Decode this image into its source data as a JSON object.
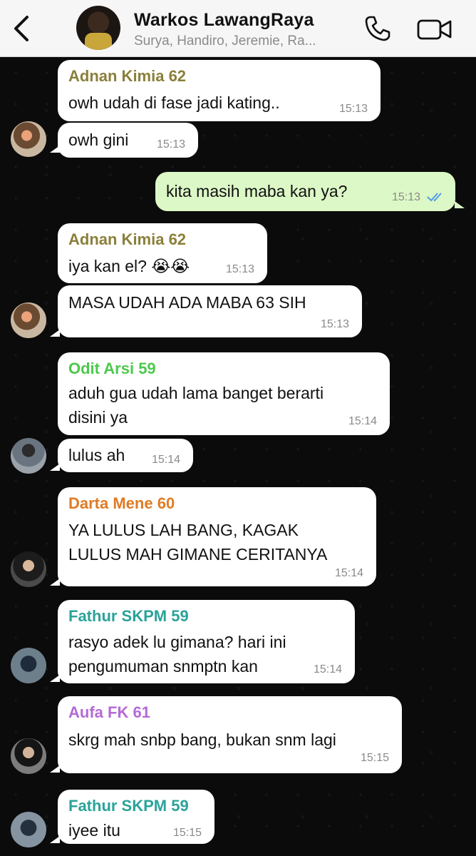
{
  "header": {
    "title": "Warkos LawangRaya",
    "subtitle": "Surya, Handiro, Jeremie, Ra..."
  },
  "icons": {
    "back": "chevron-left-icon",
    "call": "phone-icon",
    "video": "video-camera-icon",
    "read": "double-check-icon"
  },
  "colors": {
    "incoming": "#ffffff",
    "outgoing": "#dcf8c6",
    "name_adnan": "#8a7f3a",
    "name_odit": "#4cc94c",
    "name_darta": "#e07b25",
    "name_fathur": "#2aa39a",
    "name_aufa": "#b56ad6",
    "read_check": "#4f9bea"
  },
  "messages": [
    {
      "sender": "Adnan Kimia 62",
      "text": "owh udah di fase jadi kating..",
      "time": "15:13"
    },
    {
      "text": "owh gini",
      "time": "15:13"
    },
    {
      "text": "kita masih maba kan ya?",
      "time": "15:13",
      "outgoing": true
    },
    {
      "sender": "Adnan Kimia 62",
      "text": "iya kan el? 😭😭",
      "time": "15:13"
    },
    {
      "text": "MASA UDAH ADA MABA 63 SIH",
      "time": "15:13"
    },
    {
      "sender": "Odit Arsi 59",
      "text": "aduh gua udah lama banget berarti\ndisini ya",
      "time": "15:14"
    },
    {
      "text": "lulus ah",
      "time": "15:14"
    },
    {
      "sender": "Darta Mene 60",
      "text": "YA LULUS LAH BANG, KAGAK\nLULUS MAH GIMANE CERITANYA",
      "time": "15:14"
    },
    {
      "sender": "Fathur SKPM 59",
      "text": "rasyo adek lu gimana? hari ini\npengumuman snmptn kan",
      "time": "15:14"
    },
    {
      "sender": "Aufa FK 61",
      "text": "skrg mah snbp bang, bukan snm lagi",
      "time": "15:15"
    },
    {
      "sender": "Fathur SKPM 59",
      "text": "iyee itu",
      "time": "15:15"
    }
  ]
}
